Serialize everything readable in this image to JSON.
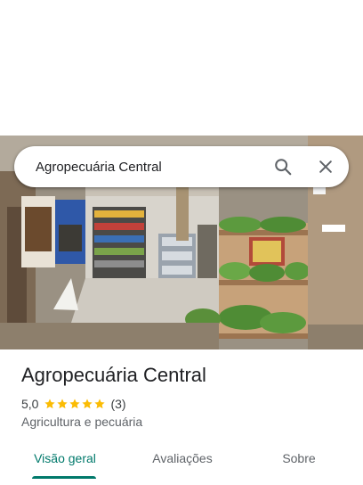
{
  "search": {
    "query": "Agropecuária Central",
    "search_icon": "search-icon",
    "close_icon": "close-icon"
  },
  "place": {
    "name": "Agropecuária Central",
    "rating": "5,0",
    "stars": 5,
    "review_count": "(3)",
    "category": "Agricultura e pecuária"
  },
  "tabs": [
    {
      "label": "Visão geral",
      "active": true
    },
    {
      "label": "Avaliações",
      "active": false
    },
    {
      "label": "Sobre",
      "active": false
    }
  ],
  "colors": {
    "accent": "#00796b",
    "star": "#fbbc04"
  }
}
